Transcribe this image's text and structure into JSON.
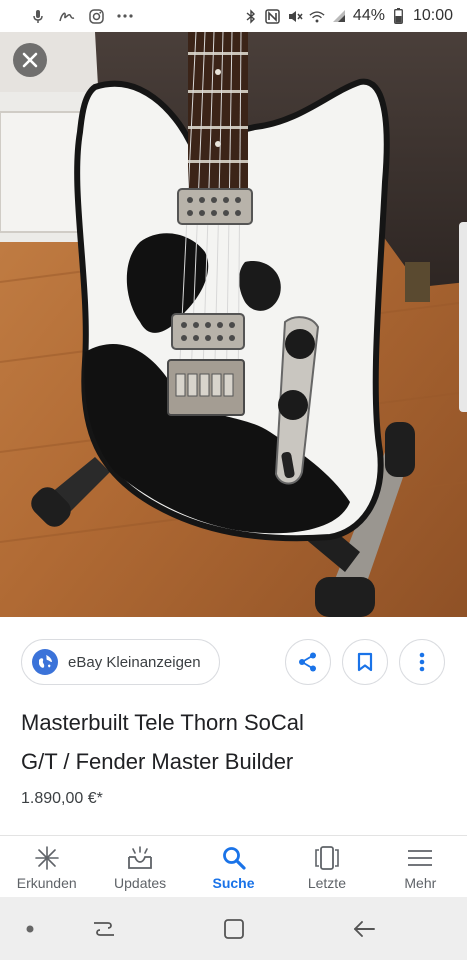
{
  "status_bar": {
    "battery": "44%",
    "time": "10:00"
  },
  "result": {
    "source": "eBay Kleinanzeigen",
    "title_line1": "Masterbuilt Tele Thorn SoCal",
    "title_line2": "G/T / Fender Master Builder",
    "price": "1.890,00 €*"
  },
  "bottom_nav": {
    "items": [
      {
        "label": "Erkunden",
        "icon": "asterisk-icon"
      },
      {
        "label": "Updates",
        "icon": "updates-icon"
      },
      {
        "label": "Suche",
        "icon": "search-icon",
        "active": true
      },
      {
        "label": "Letzte",
        "icon": "recent-cards-icon"
      },
      {
        "label": "Mehr",
        "icon": "menu-icon"
      }
    ]
  },
  "colors": {
    "accent": "#1a73e8",
    "globe": "#3b73d9",
    "nav_inactive": "#5f6368"
  }
}
